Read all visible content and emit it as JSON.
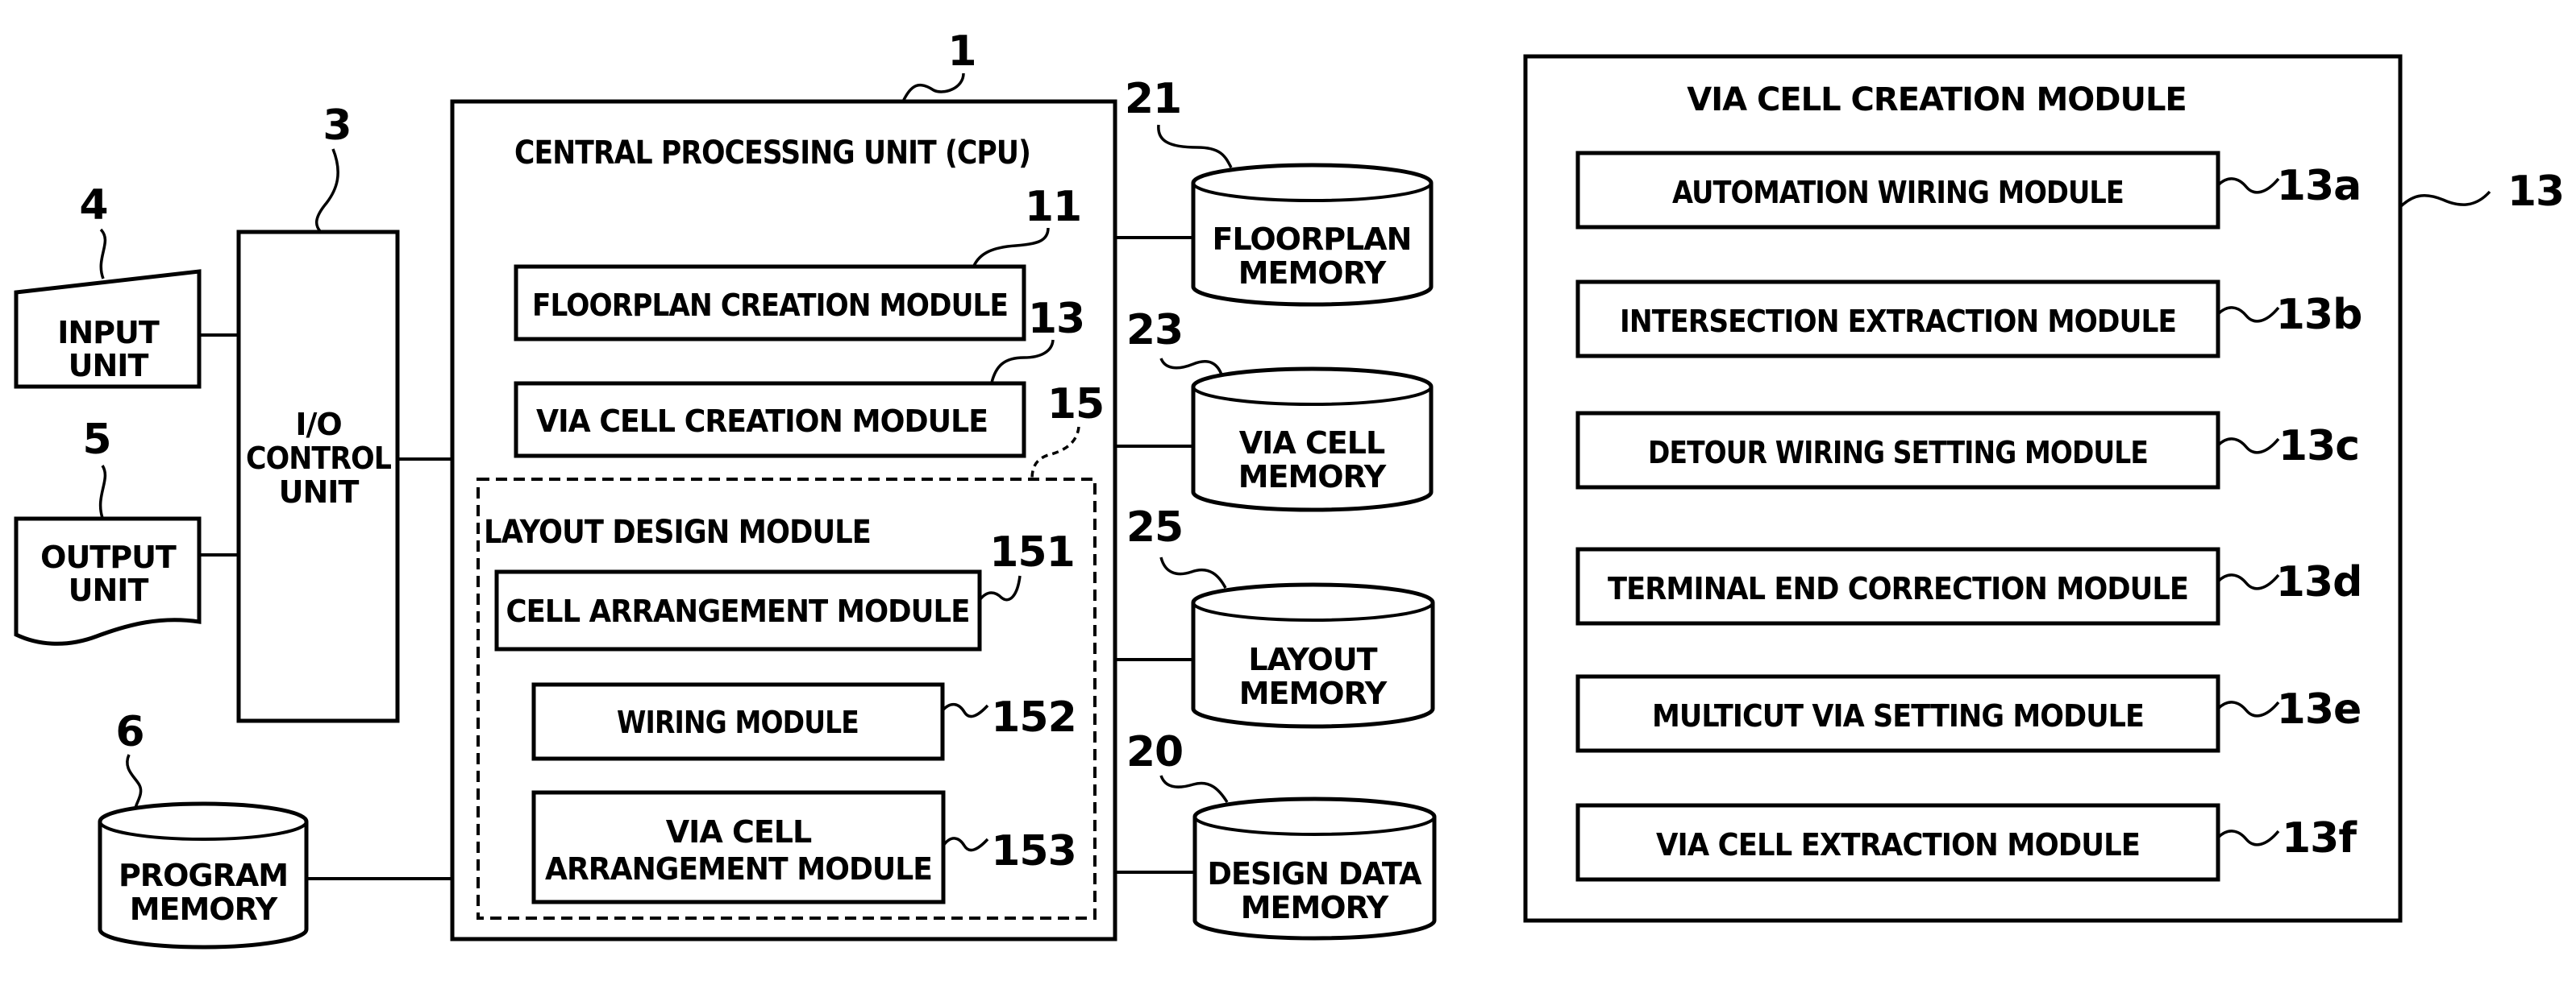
{
  "figure": {
    "io_control_unit": {
      "ref": "3",
      "lines": [
        "I/O",
        "CONTROL",
        "UNIT"
      ]
    },
    "input_unit": {
      "ref": "4",
      "lines": [
        "INPUT",
        "UNIT"
      ]
    },
    "output_unit": {
      "ref": "5",
      "lines": [
        "OUTPUT",
        "UNIT"
      ]
    },
    "program_memory": {
      "ref": "6",
      "lines": [
        "PROGRAM",
        "MEMORY"
      ]
    },
    "cpu": {
      "ref": "1",
      "title": "CENTRAL PROCESSING UNIT (CPU)",
      "floorplan_creation": {
        "ref": "11",
        "label": "FLOORPLAN CREATION MODULE"
      },
      "via_cell_creation": {
        "ref": "13",
        "label": "VIA CELL CREATION MODULE"
      },
      "layout_design": {
        "ref": "15",
        "title": "LAYOUT DESIGN MODULE",
        "cell_arrangement": {
          "ref": "151",
          "label": "CELL ARRANGEMENT MODULE"
        },
        "wiring": {
          "ref": "152",
          "label": "WIRING MODULE"
        },
        "via_cell_arrangement": {
          "ref": "153",
          "lines": [
            "VIA CELL",
            "ARRANGEMENT MODULE"
          ]
        }
      }
    },
    "memories": [
      {
        "ref": "21",
        "lines": [
          "FLOORPLAN",
          "MEMORY"
        ]
      },
      {
        "ref": "23",
        "lines": [
          "VIA CELL",
          "MEMORY"
        ]
      },
      {
        "ref": "25",
        "lines": [
          "LAYOUT",
          "MEMORY"
        ]
      },
      {
        "ref": "20",
        "lines": [
          "DESIGN DATA",
          "MEMORY"
        ]
      }
    ],
    "via_cell_creation_detail": {
      "ref": "13",
      "title": "VIA CELL CREATION MODULE",
      "modules": [
        {
          "ref": "13a",
          "label": "AUTOMATION WIRING MODULE"
        },
        {
          "ref": "13b",
          "label": "INTERSECTION EXTRACTION MODULE"
        },
        {
          "ref": "13c",
          "label": "DETOUR WIRING SETTING MODULE"
        },
        {
          "ref": "13d",
          "label": "TERMINAL END CORRECTION MODULE"
        },
        {
          "ref": "13e",
          "label": "MULTICUT VIA SETTING MODULE"
        },
        {
          "ref": "13f",
          "label": "VIA CELL EXTRACTION MODULE"
        }
      ]
    }
  }
}
